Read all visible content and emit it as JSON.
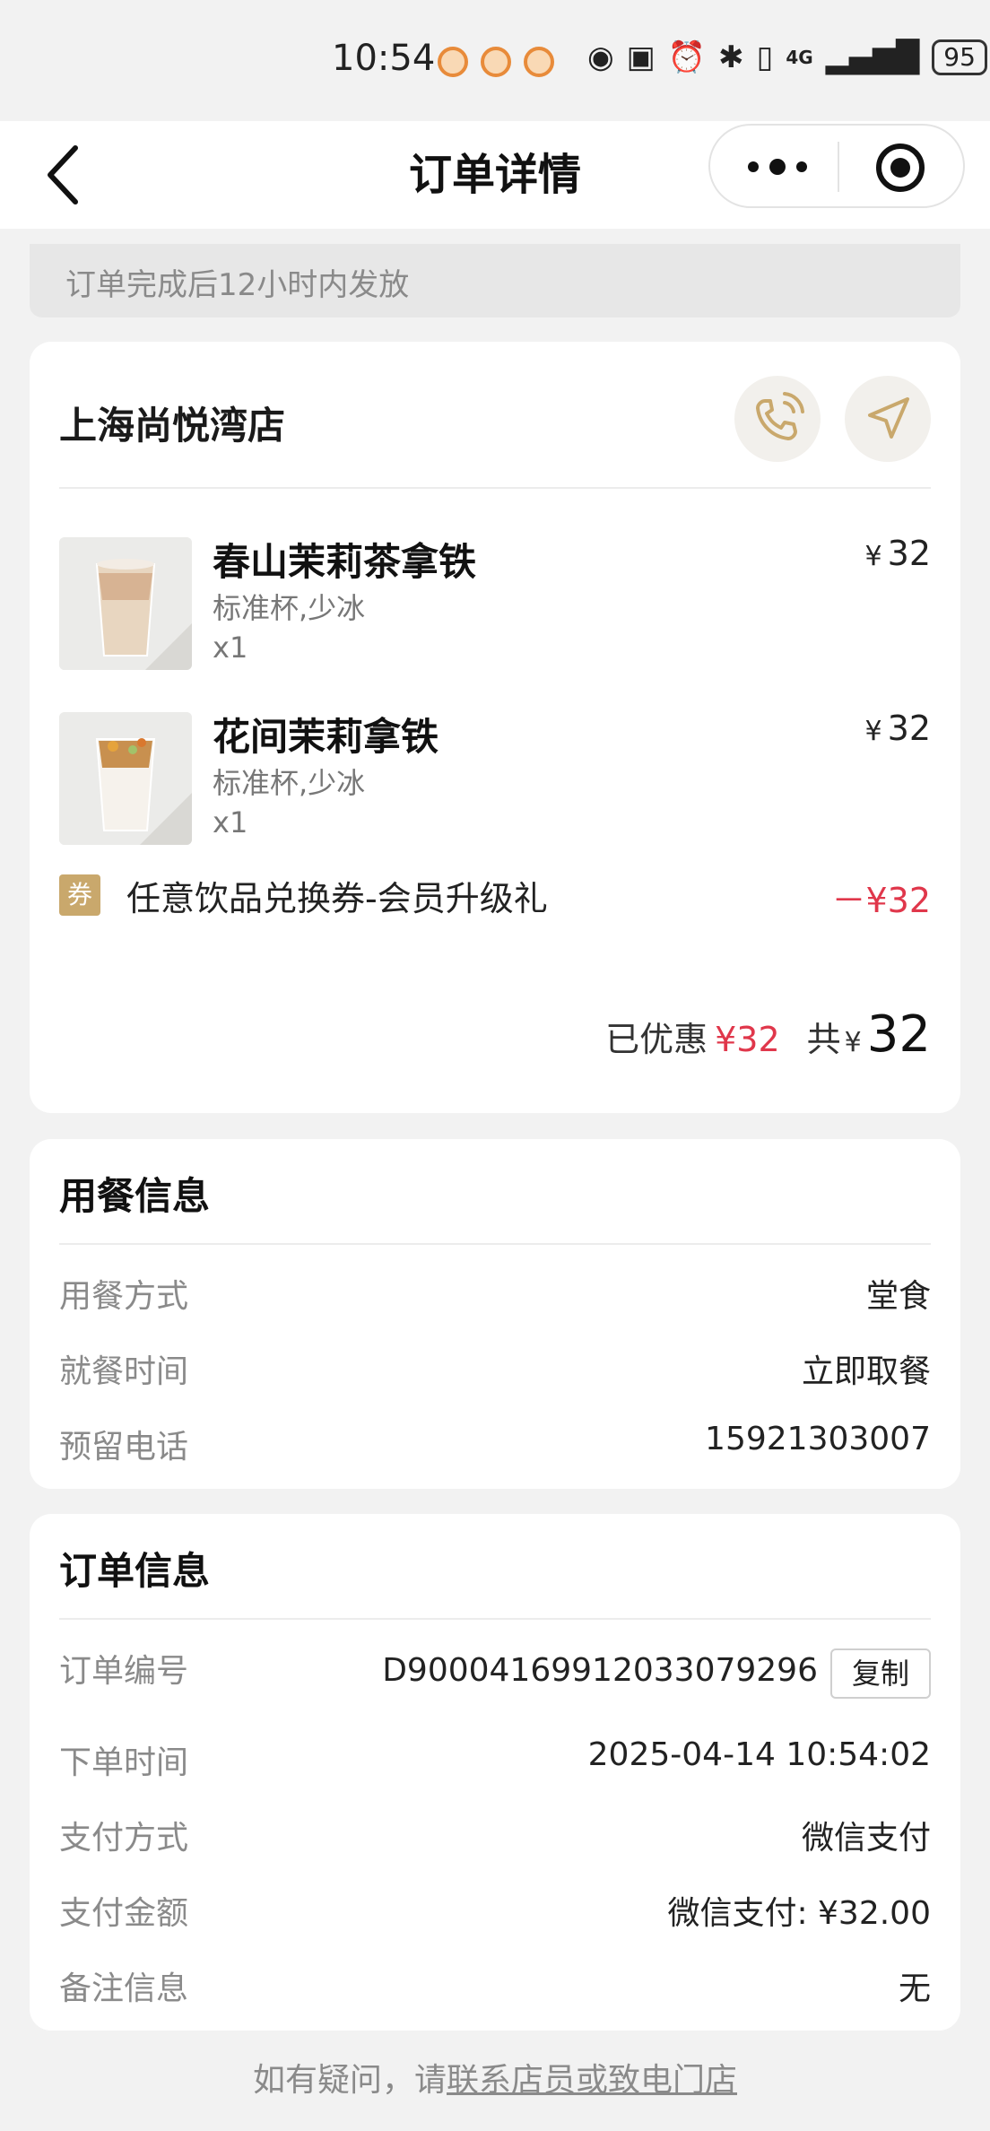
{
  "status_bar": {
    "time": "10:54",
    "battery": "95",
    "network": "4G",
    "notification_dot_color": "#e88b3a"
  },
  "nav": {
    "title": "订单详情",
    "back_icon": "chevron-left-icon",
    "more_icon": "more-dots-icon",
    "close_icon": "target-close-icon"
  },
  "notice": {
    "text": "订单完成后12小时内发放"
  },
  "store": {
    "name": "上海尚悦湾店",
    "phone_icon": "phone-icon",
    "nav_icon": "navigation-arrow-icon",
    "accent_color": "#c9a86c"
  },
  "items": [
    {
      "name": "春山茉莉茶拿铁",
      "spec": "标准杯,少冰",
      "qty": "x1",
      "currency": "¥",
      "price": "32"
    },
    {
      "name": "花间茉莉拿铁",
      "spec": "标准杯,少冰",
      "qty": "x1",
      "currency": "¥",
      "price": "32"
    }
  ],
  "coupon": {
    "tag": "券",
    "label": "任意饮品兑换券-会员升级礼",
    "amount": "－¥32",
    "color": "#e0374b"
  },
  "total": {
    "discount_label": "已优惠",
    "discount_value": "¥32",
    "total_label": "共",
    "currency": "¥",
    "total_value": "32"
  },
  "dining": {
    "title": "用餐信息",
    "rows": [
      {
        "label": "用餐方式",
        "value": "堂食"
      },
      {
        "label": "就餐时间",
        "value": "立即取餐"
      },
      {
        "label": "预留电话",
        "value": "15921303007"
      }
    ]
  },
  "order": {
    "title": "订单信息",
    "number_label": "订单编号",
    "number_value": "D900041699120330792​96",
    "copy_label": "复制",
    "rows": [
      {
        "label": "下单时间",
        "value": "2025-04-14 10:54:02"
      },
      {
        "label": "支付方式",
        "value": "微信支付"
      },
      {
        "label": "支付金额",
        "value": "微信支付: ¥32.00"
      },
      {
        "label": "备注信息",
        "value": "无"
      }
    ]
  },
  "footer": {
    "prefix": "如有疑问，请",
    "link": "联系店员或致电门店"
  }
}
